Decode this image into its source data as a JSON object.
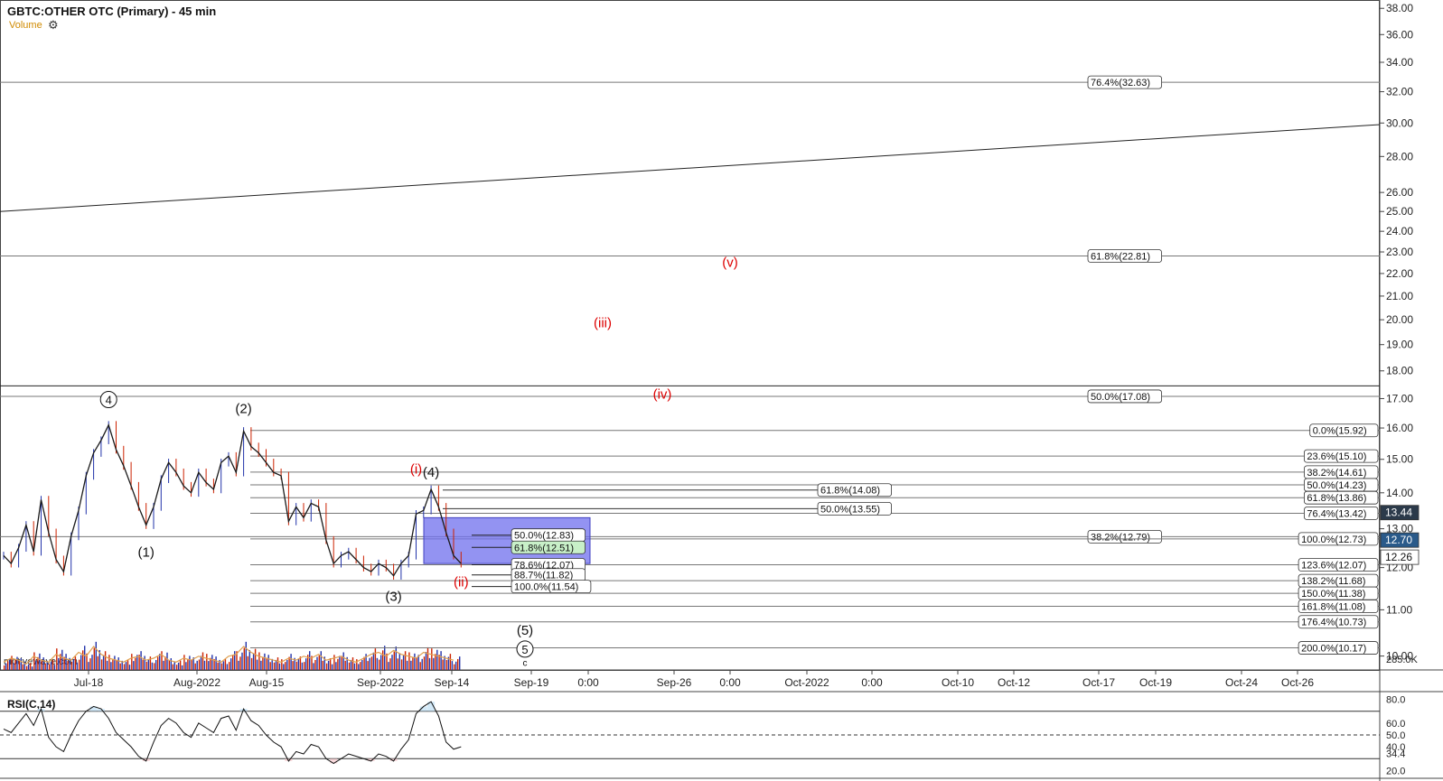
{
  "header": {
    "title": "GBTC:OTHER OTC (Primary) - 45 min",
    "volume_label": "Volume",
    "settings_icon": "gear-icon"
  },
  "watermark": "motivewave.com",
  "colors": {
    "price": "#1a1a1a",
    "up_candle": "#2233aa",
    "down_candle": "#cc2200",
    "wave_red": "#dd0000",
    "box_fill": "#6f6fee",
    "green_box": "#c8f0c8",
    "volume_ma": "#e0a050",
    "last_price": "#2a5a8a"
  },
  "chart_data": [
    {
      "type": "candlestick",
      "title": "GBTC:OTHER OTC (Primary) - 45 min",
      "y_scale": "log",
      "ylim": [
        9.7,
        38.5
      ],
      "y_ticks": [
        {
          "label": "38.00",
          "v": 38.0
        },
        {
          "label": "36.00",
          "v": 36.0
        },
        {
          "label": "34.00",
          "v": 34.0
        },
        {
          "label": "32.00",
          "v": 32.0
        },
        {
          "label": "30.00",
          "v": 30.0
        },
        {
          "label": "28.00",
          "v": 28.0
        },
        {
          "label": "26.00",
          "v": 26.0
        },
        {
          "label": "25.00",
          "v": 25.0
        },
        {
          "label": "24.00",
          "v": 24.0
        },
        {
          "label": "23.00",
          "v": 23.0
        },
        {
          "label": "22.00",
          "v": 22.0
        },
        {
          "label": "21.00",
          "v": 21.0
        },
        {
          "label": "20.00",
          "v": 20.0
        },
        {
          "label": "19.00",
          "v": 19.0
        },
        {
          "label": "18.00",
          "v": 18.0
        },
        {
          "label": "17.00",
          "v": 17.0
        },
        {
          "label": "16.00",
          "v": 16.0
        },
        {
          "label": "15.00",
          "v": 15.0
        },
        {
          "label": "14.00",
          "v": 14.0
        },
        {
          "label": "13.00",
          "v": 13.0
        },
        {
          "label": "12.00",
          "v": 12.0
        },
        {
          "label": "11.00",
          "v": 11.0
        },
        {
          "label": "10.00",
          "v": 10.0
        }
      ],
      "volume_axis_label": "285.0K",
      "x_ticks": [
        "Jul-18",
        "Aug-2022",
        "Aug-15",
        "Sep-2022",
        "Sep-14",
        "Sep-19",
        "0:00",
        "Sep-26",
        "0:00",
        "Oct-2022",
        "0:00",
        "Oct-10",
        "Oct-12",
        "Oct-17",
        "Oct-19",
        "Oct-24",
        "Oct-26"
      ],
      "price_tags": [
        {
          "label": "13.44",
          "v": 13.44,
          "style": "dark"
        },
        {
          "label": "12.70",
          "v": 12.7,
          "style": "blue"
        },
        {
          "label": "12.26",
          "v": 12.26,
          "style": "outline"
        }
      ],
      "price_path": [
        [
          0,
          12.3
        ],
        [
          1,
          12.1
        ],
        [
          2,
          12.5
        ],
        [
          3,
          13.1
        ],
        [
          4,
          12.4
        ],
        [
          5,
          13.8
        ],
        [
          6,
          12.9
        ],
        [
          7,
          12.2
        ],
        [
          8,
          11.9
        ],
        [
          9,
          12.8
        ],
        [
          10,
          13.5
        ],
        [
          11,
          14.5
        ],
        [
          12,
          15.2
        ],
        [
          13,
          15.6
        ],
        [
          14,
          16.1
        ],
        [
          15,
          15.3
        ],
        [
          16,
          14.8
        ],
        [
          17,
          14.2
        ],
        [
          18,
          13.6
        ],
        [
          19,
          13.1
        ],
        [
          20,
          13.6
        ],
        [
          21,
          14.4
        ],
        [
          22,
          14.9
        ],
        [
          23,
          14.6
        ],
        [
          24,
          14.2
        ],
        [
          25,
          14.0
        ],
        [
          26,
          14.6
        ],
        [
          27,
          14.3
        ],
        [
          28,
          14.1
        ],
        [
          29,
          14.9
        ],
        [
          30,
          15.1
        ],
        [
          31,
          14.6
        ],
        [
          32,
          15.9
        ],
        [
          33,
          15.4
        ],
        [
          34,
          15.2
        ],
        [
          35,
          14.9
        ],
        [
          36,
          14.6
        ],
        [
          37,
          14.5
        ],
        [
          38,
          13.2
        ],
        [
          39,
          13.6
        ],
        [
          40,
          13.3
        ],
        [
          41,
          13.7
        ],
        [
          42,
          13.6
        ],
        [
          43,
          12.7
        ],
        [
          44,
          12.1
        ],
        [
          45,
          12.3
        ],
        [
          46,
          12.4
        ],
        [
          47,
          12.2
        ],
        [
          48,
          12.0
        ],
        [
          49,
          11.9
        ],
        [
          50,
          12.1
        ],
        [
          51,
          12.0
        ],
        [
          52,
          11.8
        ],
        [
          53,
          12.1
        ],
        [
          54,
          12.3
        ],
        [
          55,
          13.4
        ],
        [
          56,
          13.5
        ],
        [
          57,
          14.1
        ],
        [
          58,
          13.6
        ],
        [
          59,
          12.9
        ],
        [
          60,
          12.3
        ],
        [
          61,
          12.1
        ]
      ],
      "volume": [
        4,
        6,
        5,
        3,
        7,
        5,
        4,
        8,
        6,
        5,
        9,
        7,
        12,
        8,
        6,
        5,
        4,
        6,
        7,
        5,
        6,
        8,
        5,
        4,
        6,
        5,
        7,
        6,
        5,
        4,
        7,
        8,
        12,
        9,
        7,
        6,
        5,
        4,
        6,
        5,
        7,
        6,
        8,
        5,
        6,
        7,
        5,
        4,
        6,
        8,
        9,
        7,
        10,
        8,
        7,
        6,
        9,
        8,
        7,
        6,
        5
      ],
      "rsi": {
        "title": "RSI(C,14)",
        "ylim": [
          15,
          85
        ],
        "y_ticks": [
          {
            "label": "80.0",
            "v": 80
          },
          {
            "label": "60.0",
            "v": 60
          },
          {
            "label": "50.0",
            "v": 50
          },
          {
            "label": "40.0",
            "v": 40
          },
          {
            "label": "34.4",
            "v": 34.4
          },
          {
            "label": "20.0",
            "v": 20
          }
        ],
        "levels": [
          70,
          50,
          30
        ],
        "values": [
          55,
          52,
          60,
          68,
          58,
          72,
          48,
          40,
          36,
          50,
          62,
          70,
          74,
          72,
          64,
          52,
          46,
          40,
          32,
          28,
          44,
          58,
          64,
          60,
          52,
          48,
          60,
          56,
          52,
          64,
          66,
          54,
          72,
          62,
          58,
          50,
          44,
          40,
          28,
          36,
          34,
          42,
          40,
          30,
          26,
          30,
          34,
          32,
          30,
          28,
          34,
          32,
          28,
          38,
          46,
          68,
          74,
          78,
          66,
          44,
          38,
          40
        ]
      },
      "horizontal_levels": [
        {
          "label": "76.4%(32.63)",
          "v": 32.63,
          "span": "full",
          "tag_at": "right_mid"
        },
        {
          "label": "61.8%(22.81)",
          "v": 22.81,
          "span": "full",
          "tag_at": "right_mid"
        },
        {
          "label": "50.0%(17.08)",
          "v": 17.08,
          "span": "full",
          "tag_at": "right_mid"
        },
        {
          "label": "",
          "v": 17.45,
          "span": "full",
          "tag_at": "none"
        },
        {
          "label": "0.0%(15.92)",
          "v": 15.92,
          "span": "right",
          "tag_at": "right"
        },
        {
          "label": "23.6%(15.10)",
          "v": 15.1,
          "span": "right",
          "tag_at": "right"
        },
        {
          "label": "38.2%(14.61)",
          "v": 14.61,
          "span": "right",
          "tag_at": "right"
        },
        {
          "label": "50.0%(14.23)",
          "v": 14.23,
          "span": "right",
          "tag_at": "right"
        },
        {
          "label": "61.8%(13.86)",
          "v": 13.86,
          "span": "right",
          "tag_at": "right"
        },
        {
          "label": "76.4%(13.42)",
          "v": 13.42,
          "span": "right",
          "tag_at": "right"
        },
        {
          "label": "38.2%(12.79)",
          "v": 12.79,
          "span": "full",
          "tag_at": "right_mid"
        },
        {
          "label": "100.0%(12.73)",
          "v": 12.73,
          "span": "right",
          "tag_at": "right"
        },
        {
          "label": "123.6%(12.07)",
          "v": 12.07,
          "span": "right",
          "tag_at": "right"
        },
        {
          "label": "138.2%(11.68)",
          "v": 11.68,
          "span": "right",
          "tag_at": "right"
        },
        {
          "label": "150.0%(11.38)",
          "v": 11.38,
          "span": "right",
          "tag_at": "right"
        },
        {
          "label": "161.8%(11.08)",
          "v": 11.08,
          "span": "right",
          "tag_at": "right"
        },
        {
          "label": "176.4%(10.73)",
          "v": 10.73,
          "span": "right",
          "tag_at": "right"
        },
        {
          "label": "200.0%(10.17)",
          "v": 10.17,
          "span": "right",
          "tag_at": "right"
        }
      ],
      "short_levels": [
        {
          "label": "61.8%(14.08)",
          "v": 14.08
        },
        {
          "label": "50.0%(13.55)",
          "v": 13.55
        }
      ],
      "box_levels": [
        {
          "label": "50.0%(12.83)",
          "v": 12.83,
          "green": false
        },
        {
          "label": "61.8%(12.51)",
          "v": 12.51,
          "green": true
        },
        {
          "label": "78.6%(12.07)",
          "v": 12.07,
          "green": false
        },
        {
          "label": "88.7%(11.82)",
          "v": 11.82,
          "green": false
        },
        {
          "label": "100.0%(11.54)",
          "v": 11.54,
          "green": false
        }
      ],
      "box_range": [
        12.1,
        13.3
      ],
      "trendline": {
        "from": 25.0,
        "to": 29.9
      },
      "wave_labels": [
        {
          "text": "4",
          "circled": true,
          "red": false,
          "x_index": 14,
          "v": 16.5,
          "pos": "above"
        },
        {
          "text": "(1)",
          "circled": false,
          "red": false,
          "x_index": 19,
          "v": 12.6,
          "pos": "below"
        },
        {
          "text": "(2)",
          "circled": false,
          "red": false,
          "x_index": 32,
          "v": 16.2,
          "pos": "above"
        },
        {
          "text": "(3)",
          "circled": false,
          "red": false,
          "x_index": 52,
          "v": 11.5,
          "pos": "below"
        },
        {
          "text": "(i)",
          "circled": false,
          "red": true,
          "x_index": 55,
          "v": 14.3,
          "pos": "above"
        },
        {
          "text": "(4)",
          "circled": false,
          "red": false,
          "x_index": 57,
          "v": 14.2,
          "pos": "above"
        },
        {
          "text": "(ii)",
          "circled": false,
          "red": true,
          "x_index": 61,
          "v": 11.85,
          "pos": "below"
        },
        {
          "text": "(iii)",
          "circled": false,
          "red": true,
          "x_index": null,
          "v": 19.7,
          "pos": "free"
        },
        {
          "text": "(iv)",
          "circled": false,
          "red": true,
          "x_index": null,
          "v": 17.0,
          "pos": "free"
        },
        {
          "text": "(v)",
          "circled": false,
          "red": true,
          "x_index": null,
          "v": 22.3,
          "pos": "free"
        },
        {
          "text": "(5)",
          "circled": false,
          "red": false,
          "x_index": null,
          "v": 10.45,
          "pos": "free"
        },
        {
          "text": "5",
          "circled": true,
          "red": false,
          "x_index": null,
          "v": 10.05,
          "pos": "free"
        },
        {
          "text": "c",
          "circled": false,
          "red": false,
          "x_index": null,
          "v": 9.8,
          "pos": "free"
        }
      ]
    }
  ]
}
